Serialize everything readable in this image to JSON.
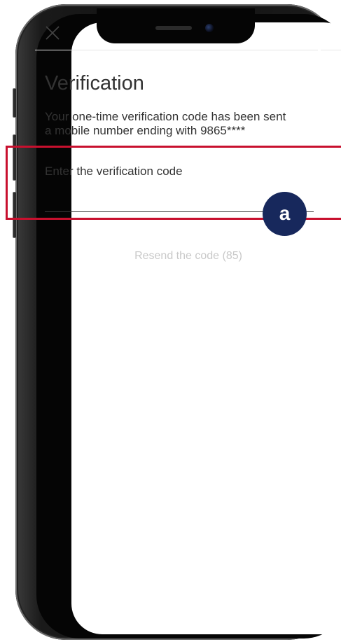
{
  "screen": {
    "title": "Verification",
    "description_line1": "Your one-time verification code has been sent",
    "description_line2": "a mobile number ending with 9865****",
    "field_label": "Enter the verification code",
    "code_value": "",
    "resend_label": "Resend the code (85)"
  },
  "icons": {
    "close": "close-icon"
  },
  "annotation": {
    "callout": "a",
    "highlight_color": "#c8102e",
    "badge_color": "#17285c"
  },
  "colors": {
    "text": "#333333",
    "disabled_text": "#c9c9c9",
    "divider": "#e5e5e5"
  }
}
